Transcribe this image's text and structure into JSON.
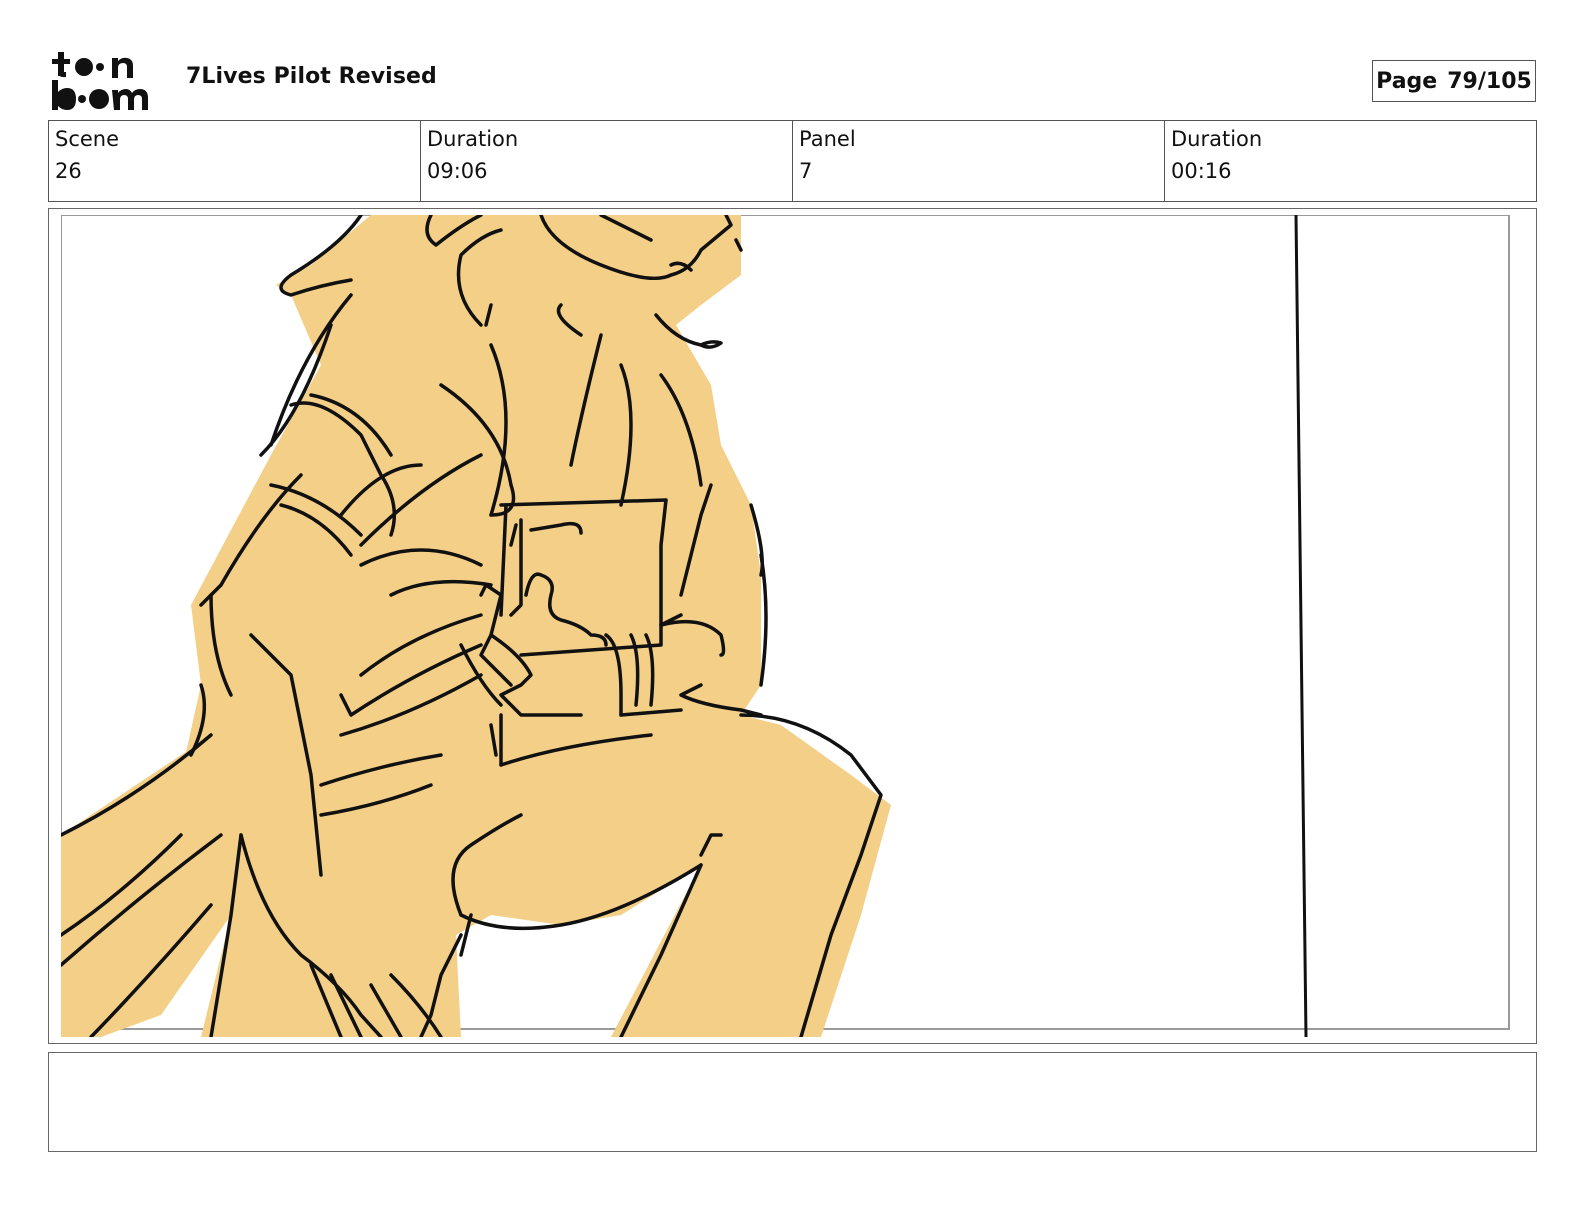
{
  "header": {
    "logo_icon": "toonboom-logo-icon",
    "title": "7Lives Pilot Revised",
    "page_label": "Page",
    "page_number": "79/105"
  },
  "info": {
    "scene_label": "Scene",
    "scene_value": "26",
    "scene_duration_label": "Duration",
    "scene_duration_value": "09:06",
    "panel_label": "Panel",
    "panel_value": "7",
    "panel_duration_label": "Duration",
    "panel_duration_value": "00:16"
  },
  "colors": {
    "fill": "#f4cf87",
    "ink": "#111111",
    "border": "#555555"
  }
}
